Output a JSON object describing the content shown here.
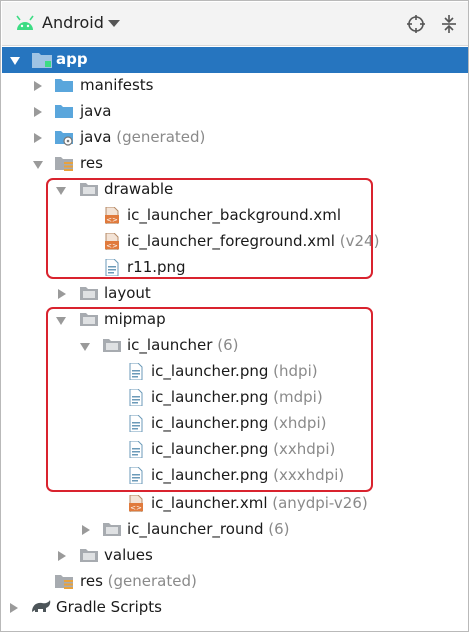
{
  "toolbar": {
    "view_mode": "Android",
    "icons": [
      "android-icon",
      "chevron-down-icon",
      "locate-target-icon",
      "collapse-all-icon"
    ]
  },
  "tree": {
    "app": "app",
    "manifests": "manifests",
    "java": "java",
    "java_generated": {
      "name": "java",
      "hint": "(generated)"
    },
    "res": "res",
    "drawable": "drawable",
    "ic_launcher_background": "ic_launcher_background.xml",
    "ic_launcher_foreground": {
      "name": "ic_launcher_foreground.xml",
      "hint": "(v24)"
    },
    "r11": "r11.png",
    "layout": "layout",
    "mipmap": "mipmap",
    "ic_launcher_dir": {
      "name": "ic_launcher",
      "hint": "(6)"
    },
    "pngs": [
      {
        "name": "ic_launcher.png",
        "hint": "(hdpi)"
      },
      {
        "name": "ic_launcher.png",
        "hint": "(mdpi)"
      },
      {
        "name": "ic_launcher.png",
        "hint": "(xhdpi)"
      },
      {
        "name": "ic_launcher.png",
        "hint": "(xxhdpi)"
      },
      {
        "name": "ic_launcher.png",
        "hint": "(xxxhdpi)"
      }
    ],
    "ic_launcher_xml": {
      "name": "ic_launcher.xml",
      "hint": "(anydpi-v26)"
    },
    "ic_launcher_round": {
      "name": "ic_launcher_round",
      "hint": "(6)"
    },
    "values": "values",
    "res_generated": {
      "name": "res",
      "hint": "(generated)"
    },
    "gradle_scripts": "Gradle Scripts"
  },
  "colors": {
    "selection": "#2675bf",
    "highlight_border": "#d9232e",
    "folder_blue": "#5aa6dc",
    "folder_gray": "#a7abb0",
    "xml_orange": "#e07a3c"
  }
}
